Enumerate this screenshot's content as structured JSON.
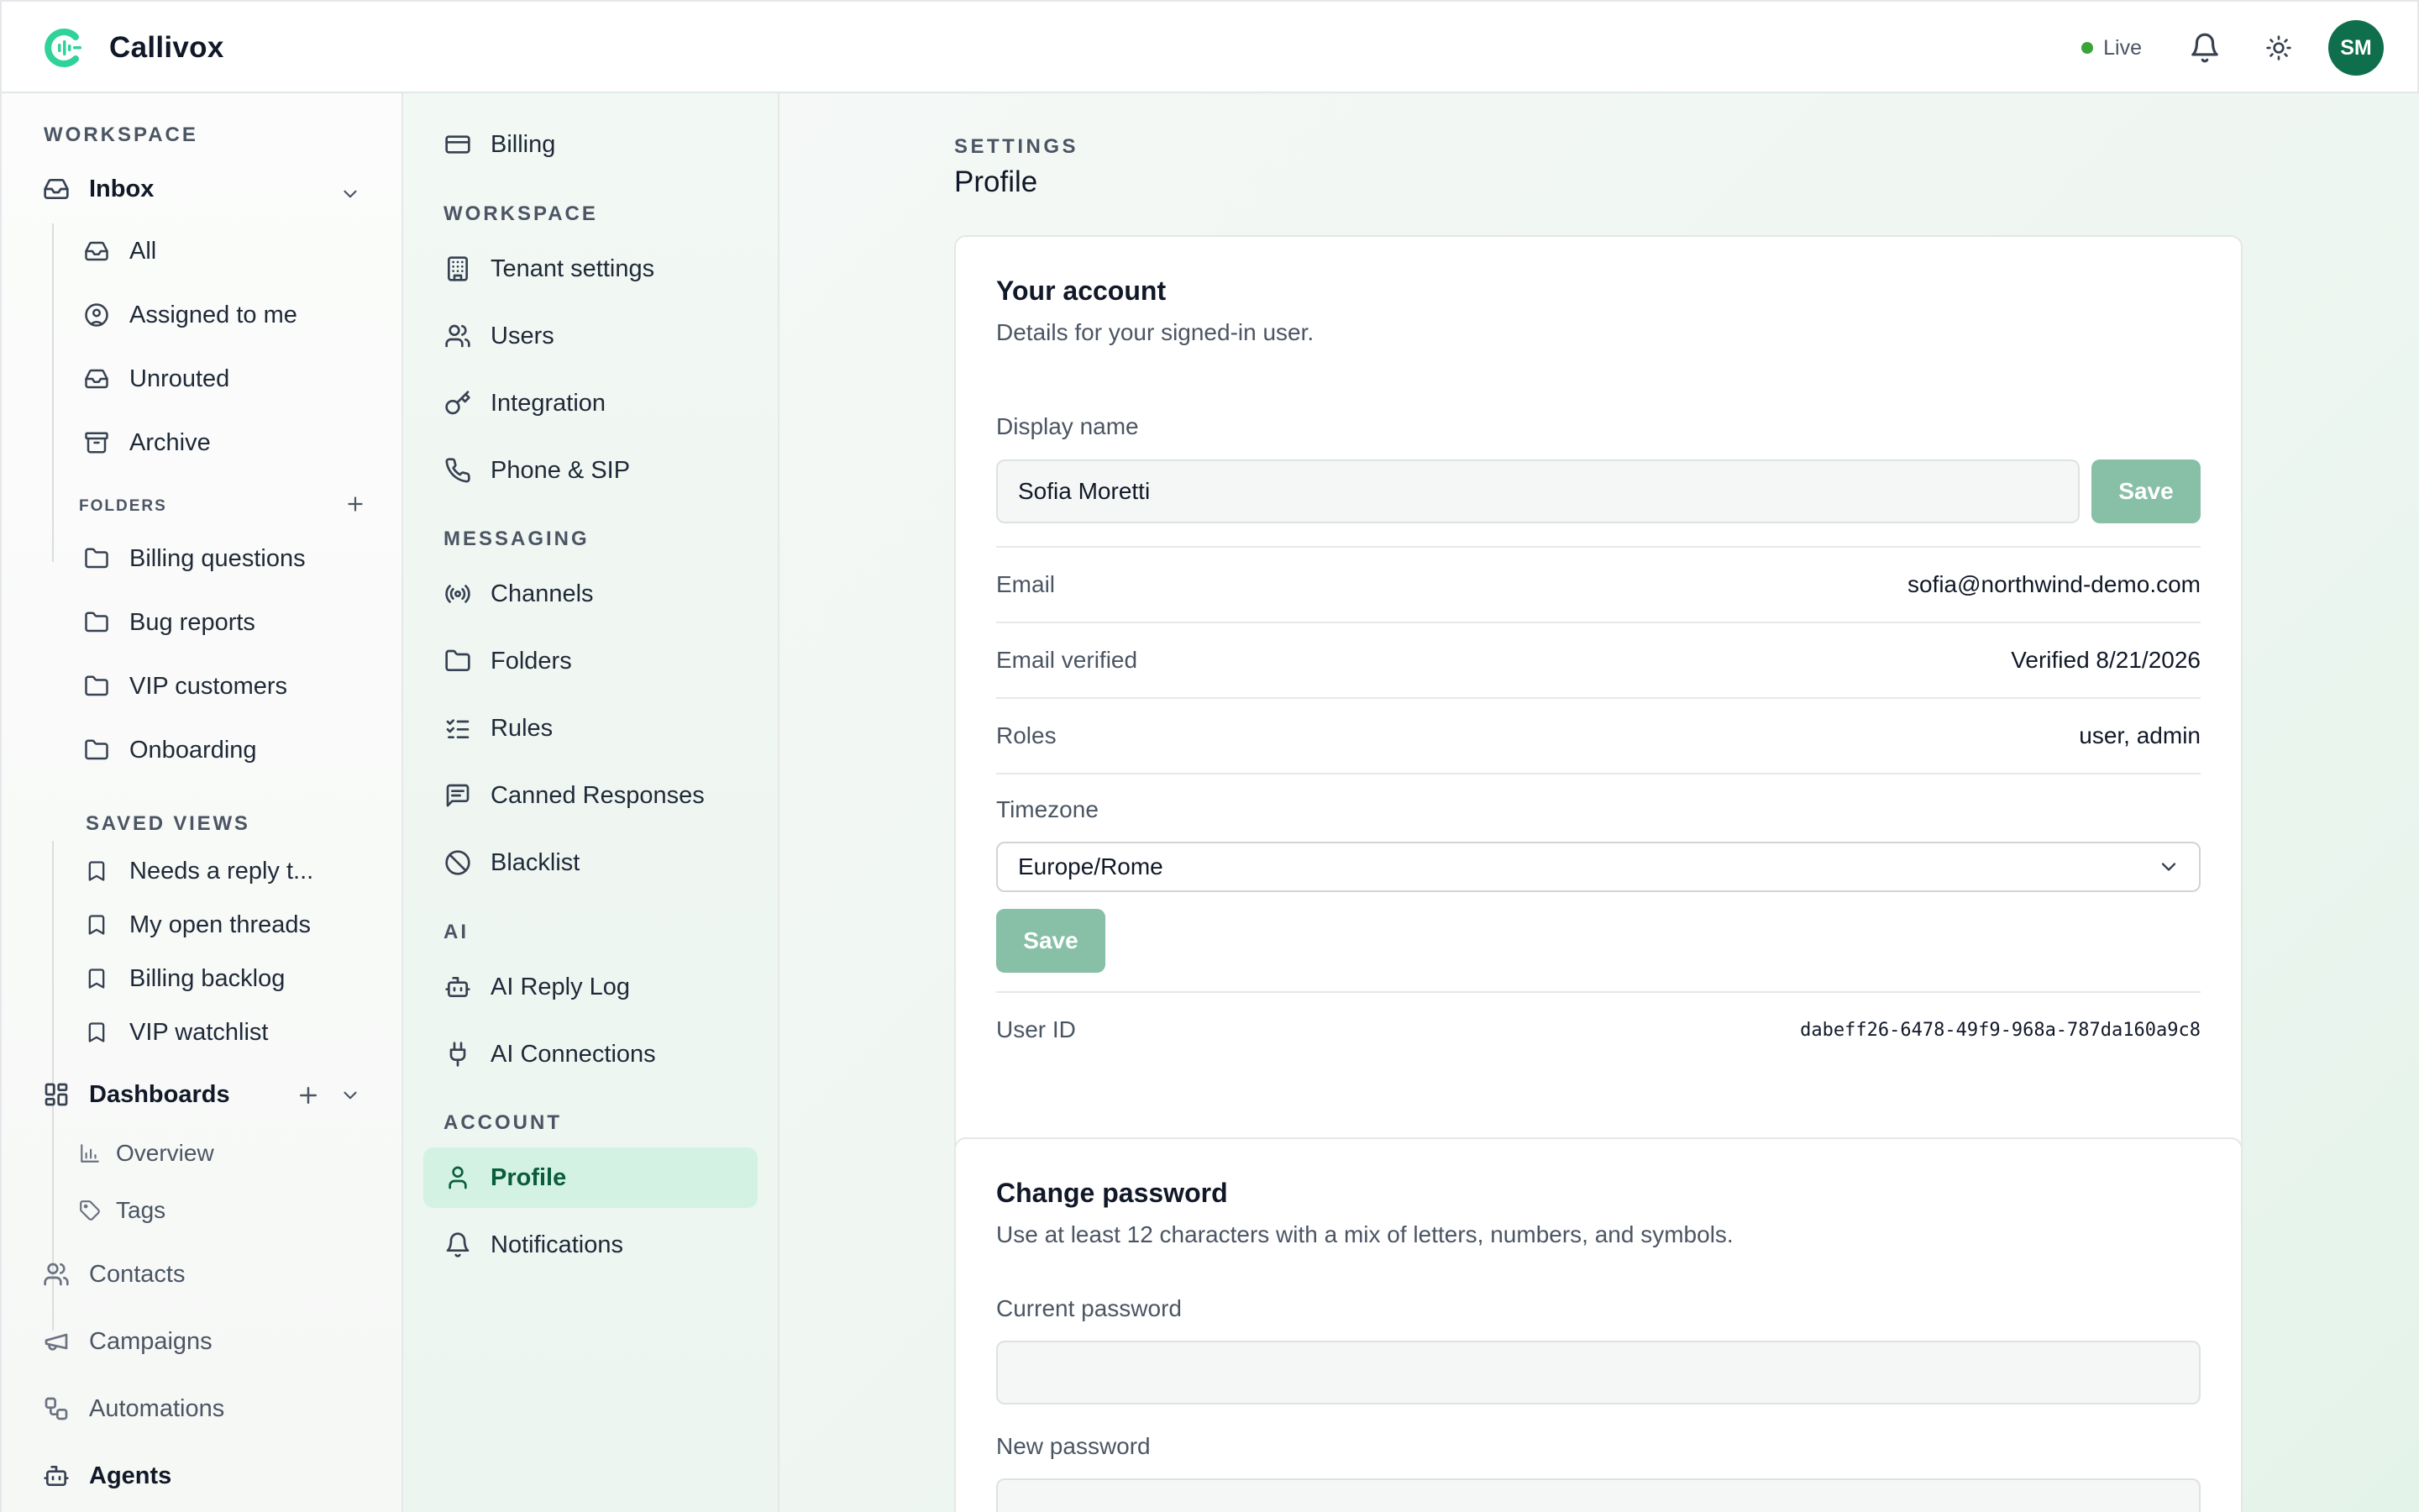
{
  "app": {
    "name": "Callivox",
    "live_label": "Live",
    "user_initials": "SM",
    "accent_color": "#0f6e4b",
    "brand_color": "#2fd39a"
  },
  "sidebar": {
    "workspace_label": "WORKSPACE",
    "inbox_label": "Inbox",
    "inbox_items": [
      "All",
      "Assigned to me",
      "Unrouted",
      "Archive"
    ],
    "folders_label": "FOLDERS",
    "folders": [
      "Billing questions",
      "Bug reports",
      "VIP customers",
      "Onboarding"
    ],
    "saved_views_label": "SAVED VIEWS",
    "saved_views": [
      "Needs a reply t...",
      "My open threads",
      "Billing backlog",
      "VIP watchlist"
    ],
    "dashboards_label": "Dashboards",
    "dashboard_items": [
      "Overview",
      "Tags"
    ],
    "contacts_label": "Contacts",
    "campaigns_label": "Campaigns",
    "automations_label": "Automations",
    "agents_label": "Agents"
  },
  "settings_nav": {
    "billing": "Billing",
    "workspace_label": "WORKSPACE",
    "workspace_items": [
      "Tenant settings",
      "Users",
      "Integration",
      "Phone & SIP"
    ],
    "messaging_label": "MESSAGING",
    "messaging_items": [
      "Channels",
      "Folders",
      "Rules",
      "Canned Responses",
      "Blacklist"
    ],
    "ai_label": "AI",
    "ai_items": [
      "AI Reply Log",
      "AI Connections"
    ],
    "account_label": "ACCOUNT",
    "account_items": [
      "Profile",
      "Notifications"
    ],
    "active_item": "Profile"
  },
  "page": {
    "eyebrow": "SETTINGS",
    "title": "Profile"
  },
  "account_card": {
    "title": "Your account",
    "subtitle": "Details for your signed-in user.",
    "display_name_label": "Display name",
    "display_name_value": "Sofia Moretti",
    "save_label": "Save",
    "email_label": "Email",
    "email_value": "sofia@northwind-demo.com",
    "email_verified_label": "Email verified",
    "email_verified_value": "Verified 8/21/2026",
    "roles_label": "Roles",
    "roles_value": "user, admin",
    "timezone_label": "Timezone",
    "timezone_value": "Europe/Rome",
    "timezone_save_label": "Save",
    "user_id_label": "User ID",
    "user_id_value": "dabeff26-6478-49f9-968a-787da160a9c8"
  },
  "password_card": {
    "title": "Change password",
    "subtitle": "Use at least 12 characters with a mix of letters, numbers, and symbols.",
    "current_label": "Current password",
    "current_value": "",
    "new_label": "New password",
    "new_value": ""
  }
}
